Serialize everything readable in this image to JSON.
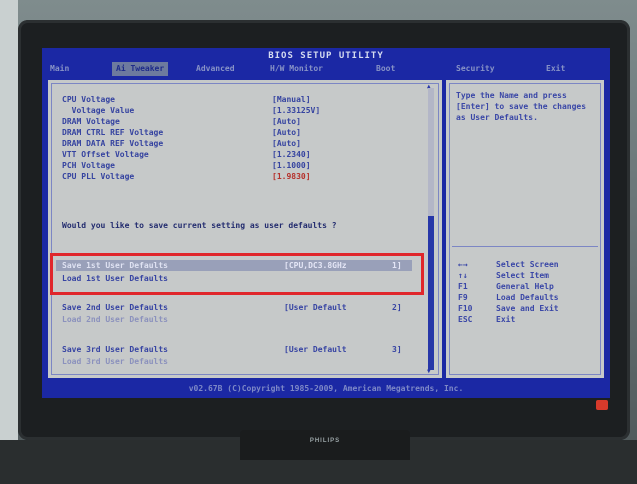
{
  "bios": {
    "title": "BIOS SETUP UTILITY",
    "menu": [
      "Main",
      "Ai Tweaker",
      "Advanced",
      "H/W Monitor",
      "Boot",
      "Security",
      "Exit"
    ],
    "active_menu": "Ai Tweaker"
  },
  "settings": [
    {
      "label": "CPU Voltage",
      "value": "[Manual]"
    },
    {
      "label": "  Voltage Value",
      "value": "[1.33125V]"
    },
    {
      "label": "DRAM Voltage",
      "value": "[Auto]"
    },
    {
      "label": "DRAM CTRL REF Voltage",
      "value": "[Auto]"
    },
    {
      "label": "DRAM DATA REF Voltage",
      "value": "[Auto]"
    },
    {
      "label": "VTT Offset Voltage",
      "value": "[1.2340]"
    },
    {
      "label": "PCH Voltage",
      "value": "[1.1000]"
    },
    {
      "label": "CPU PLL Voltage",
      "value": "[1.9830]"
    }
  ],
  "prompt": "Would you like to save current setting as user defaults ?",
  "profiles": [
    {
      "save": "Save 1st User Defaults",
      "load": "Load 1st User Defaults",
      "value": "[CPU,DC3.8GHz",
      "num": "1]"
    },
    {
      "save": "Save 2nd User Defaults",
      "load": "Load 2nd User Defaults",
      "value": "[User Default",
      "num": "2]"
    },
    {
      "save": "Save 3rd User Defaults",
      "load": "Load 3rd User Defaults",
      "value": "[User Default",
      "num": "3]"
    }
  ],
  "help_text": "Type the Name and press [Enter] to save the changes as User Defaults.",
  "keys": [
    {
      "key": "←→",
      "desc": "Select Screen"
    },
    {
      "key": "↑↓",
      "desc": "Select Item"
    },
    {
      "key": "F1",
      "desc": "General Help"
    },
    {
      "key": "F9",
      "desc": "Load Defaults"
    },
    {
      "key": "F10",
      "desc": "Save and Exit"
    },
    {
      "key": "ESC",
      "desc": "Exit"
    }
  ],
  "footer": "v02.67B (C)Copyright 1985-2009, American Megatrends, Inc.",
  "monitor": {
    "brand": "PHILIPS"
  },
  "colors": {
    "bios_blue": "#1b28a4",
    "panel_gray": "#c6c9c9",
    "highlight_red": "#e0262b"
  }
}
